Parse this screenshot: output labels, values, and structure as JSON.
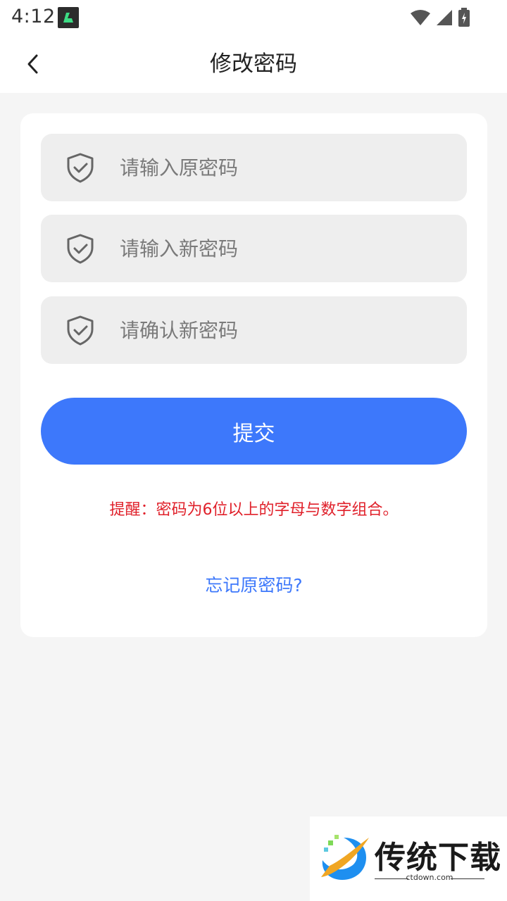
{
  "status_bar": {
    "time": "4:12"
  },
  "header": {
    "title": "修改密码",
    "back_icon": "chevron-left-icon"
  },
  "form": {
    "fields": [
      {
        "placeholder": "请输入原密码",
        "value": "",
        "icon": "shield-check-icon"
      },
      {
        "placeholder": "请输入新密码",
        "value": "",
        "icon": "shield-check-icon"
      },
      {
        "placeholder": "请确认新密码",
        "value": "",
        "icon": "shield-check-icon"
      }
    ],
    "submit_label": "提交",
    "hint": "提醒：密码为6位以上的字母与数字组合。",
    "forgot_link": "忘记原密码?"
  },
  "watermark": {
    "text": "传统下载",
    "url": "ctdown.com"
  },
  "colors": {
    "accent": "#3d78fb",
    "hint": "#e0202a",
    "field_bg": "#eeeeee",
    "page_bg": "#f5f5f5"
  }
}
